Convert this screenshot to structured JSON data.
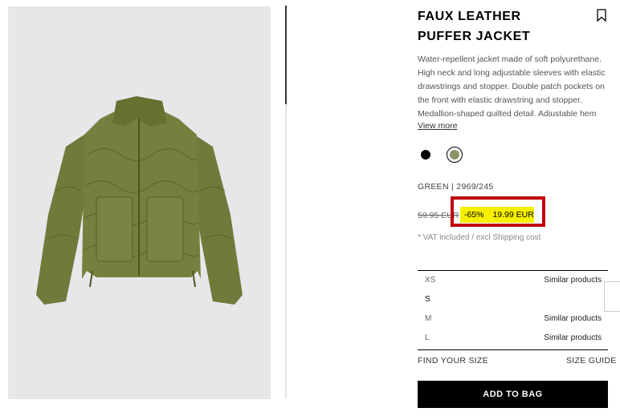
{
  "product": {
    "title": "FAUX LEATHER PUFFER JACKET",
    "description": "Water-repellent jacket made of soft polyurethane. High neck and long adjustable sleeves with elastic drawstrings and stopper. Double patch pockets on the front with elastic drawstring and stopper. Medallion-shaped quilted detail. Adjustable hem",
    "view_more": "View more",
    "color_code": "GREEN | 2969/245",
    "old_price": "59.95 EUR",
    "discount": "-65%",
    "price": "19.99 EUR",
    "vat_note": "* VAT included / excl Shipping cost"
  },
  "colors": [
    {
      "name": "black",
      "hex": "#000000"
    },
    {
      "name": "green",
      "hex": "#8b9466",
      "selected": true
    }
  ],
  "sizes": [
    {
      "label": "XS",
      "note": "Similar products"
    },
    {
      "label": "S",
      "note": ""
    },
    {
      "label": "M",
      "note": "Similar products"
    },
    {
      "label": "L",
      "note": "Similar products"
    }
  ],
  "actions": {
    "find_size": "FIND YOUR SIZE",
    "size_guide": "SIZE GUIDE",
    "add_to_bag": "ADD TO BAG"
  },
  "icons": {
    "bookmark": "bookmark-icon"
  },
  "theme": {
    "highlight": "#f6ef00",
    "annotation_border": "#c00010",
    "jacket": "#6f7a3b"
  }
}
